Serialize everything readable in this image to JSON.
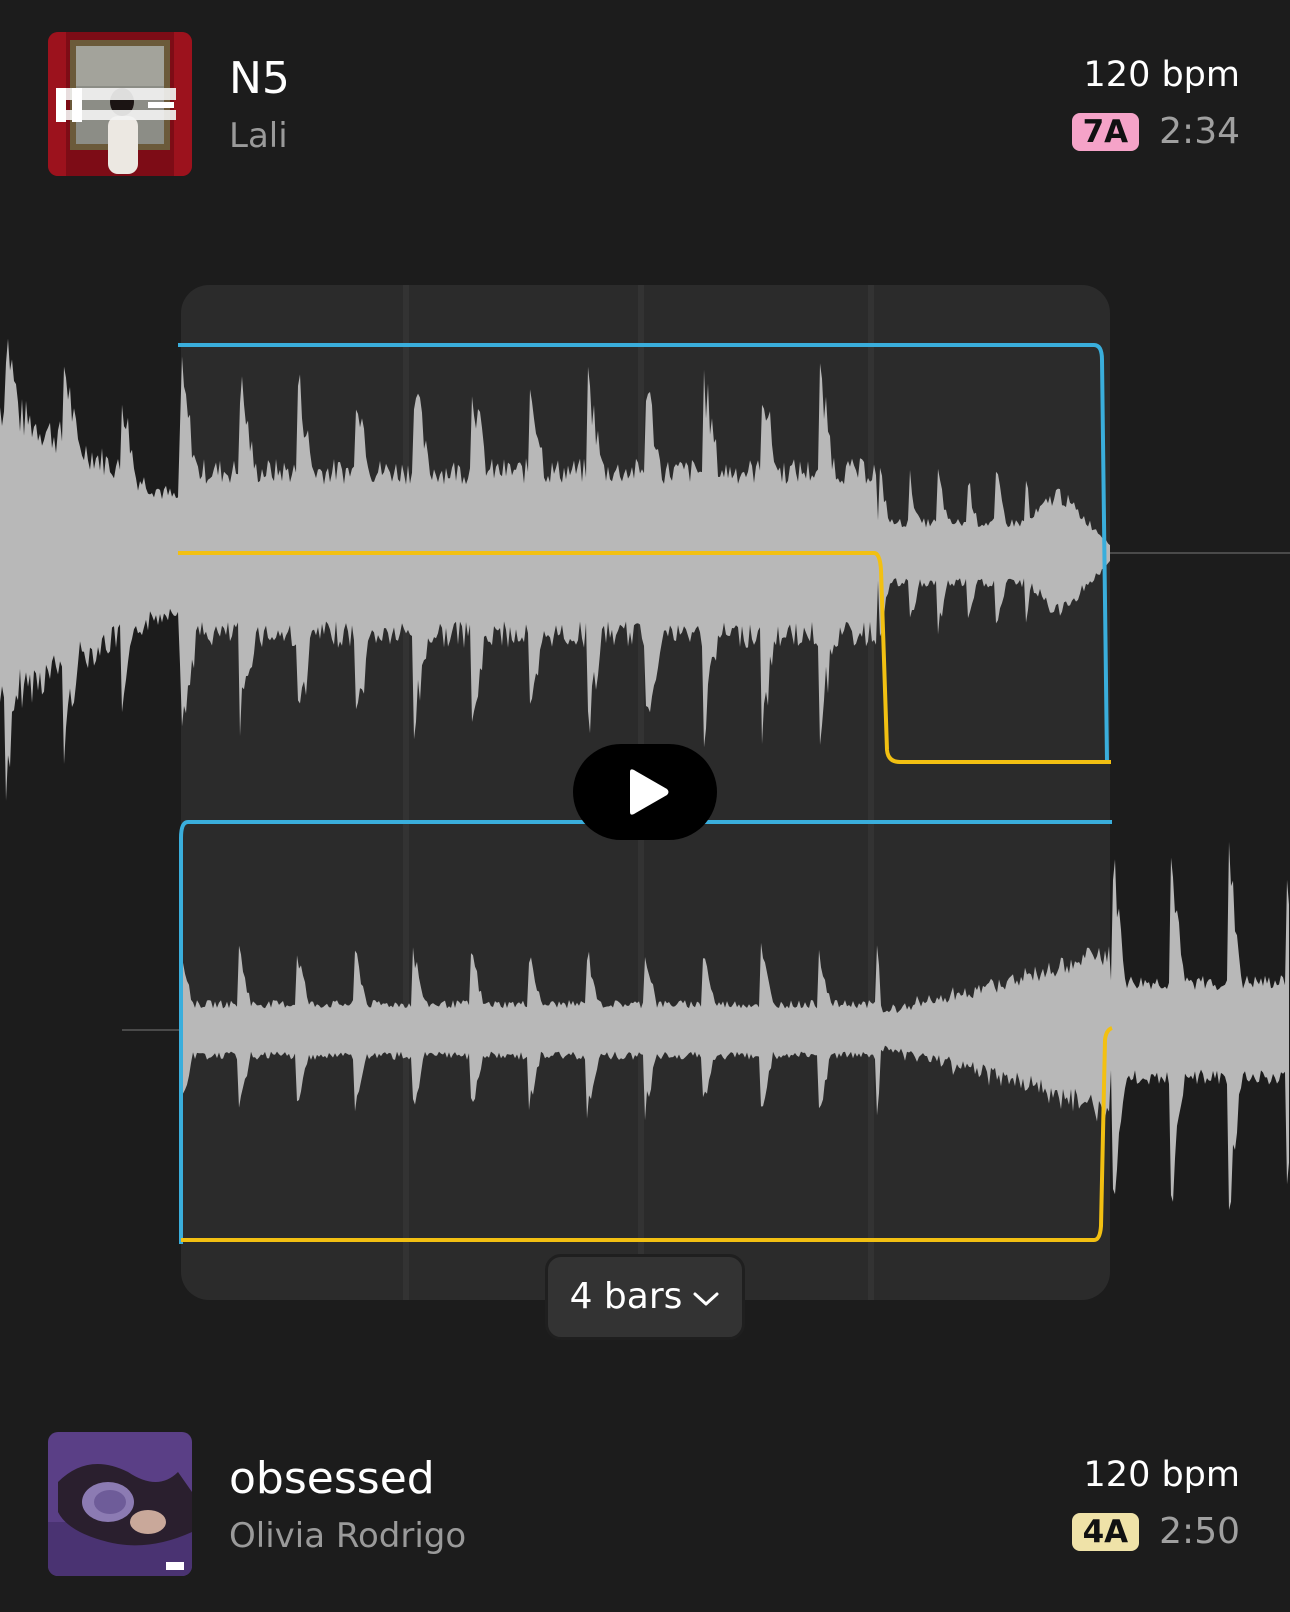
{
  "colors": {
    "background": "#1c1c1c",
    "panel": "#2b2b2b",
    "waveform": "#b8b8b8",
    "automation_volume": "#3aaedc",
    "automation_eq": "#f2c012",
    "key_badge_7a": "#f5a3c8",
    "key_badge_4a": "#efe2a8"
  },
  "tracks": [
    {
      "title": "N5",
      "artist": "Lali",
      "bpm": "120 bpm",
      "key": "7A",
      "duration": "2:34",
      "cover_icon": "album-cover-n5-icon"
    },
    {
      "title": "obsessed",
      "artist": "Olivia Rodrigo",
      "bpm": "120 bpm",
      "key": "4A",
      "duration": "2:50",
      "cover_icon": "album-cover-obsessed-icon"
    }
  ],
  "transition": {
    "bars_label": "4 bars",
    "bar_count": 4,
    "play_icon": "play-icon",
    "dropdown_icon": "chevron-down-icon"
  }
}
